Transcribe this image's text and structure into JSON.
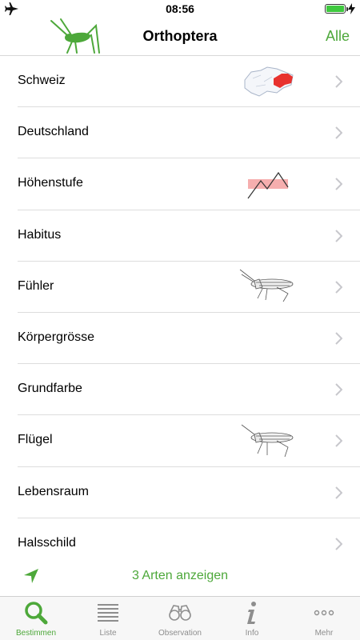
{
  "status_bar": {
    "time": "08:56",
    "airplane_icon": "airplane-icon",
    "battery_icon": "battery-icon"
  },
  "nav": {
    "title": "Orthoptera",
    "right_button": "Alle",
    "logo_icon": "grasshopper-logo-icon"
  },
  "list": {
    "items": [
      {
        "label": "Schweiz",
        "thumbnail": "switzerland-map-icon"
      },
      {
        "label": "Deutschland"
      },
      {
        "label": "Höhenstufe",
        "thumbnail": "elevation-icon"
      },
      {
        "label": "Habitus"
      },
      {
        "label": "Fühler",
        "thumbnail": "grasshopper-sketch-icon"
      },
      {
        "label": "Körpergrösse"
      },
      {
        "label": "Grundfarbe"
      },
      {
        "label": "Flügel",
        "thumbnail": "grasshopper-sketch-icon"
      },
      {
        "label": "Lebensraum"
      },
      {
        "label": "Halsschild"
      }
    ]
  },
  "action": {
    "label": "3 Arten anzeigen",
    "locate_icon": "location-arrow-icon"
  },
  "tabs": [
    {
      "label": "Bestimmen",
      "icon": "search-icon",
      "active": true
    },
    {
      "label": "Liste",
      "icon": "list-icon",
      "active": false
    },
    {
      "label": "Observation",
      "icon": "binoculars-icon",
      "active": false
    },
    {
      "label": "Info",
      "icon": "info-icon",
      "active": false
    },
    {
      "label": "Mehr",
      "icon": "more-icon",
      "active": false
    }
  ],
  "colors": {
    "accent": "#4da83a",
    "highlight_red": "#e8322e",
    "battery": "#3fc93f"
  }
}
